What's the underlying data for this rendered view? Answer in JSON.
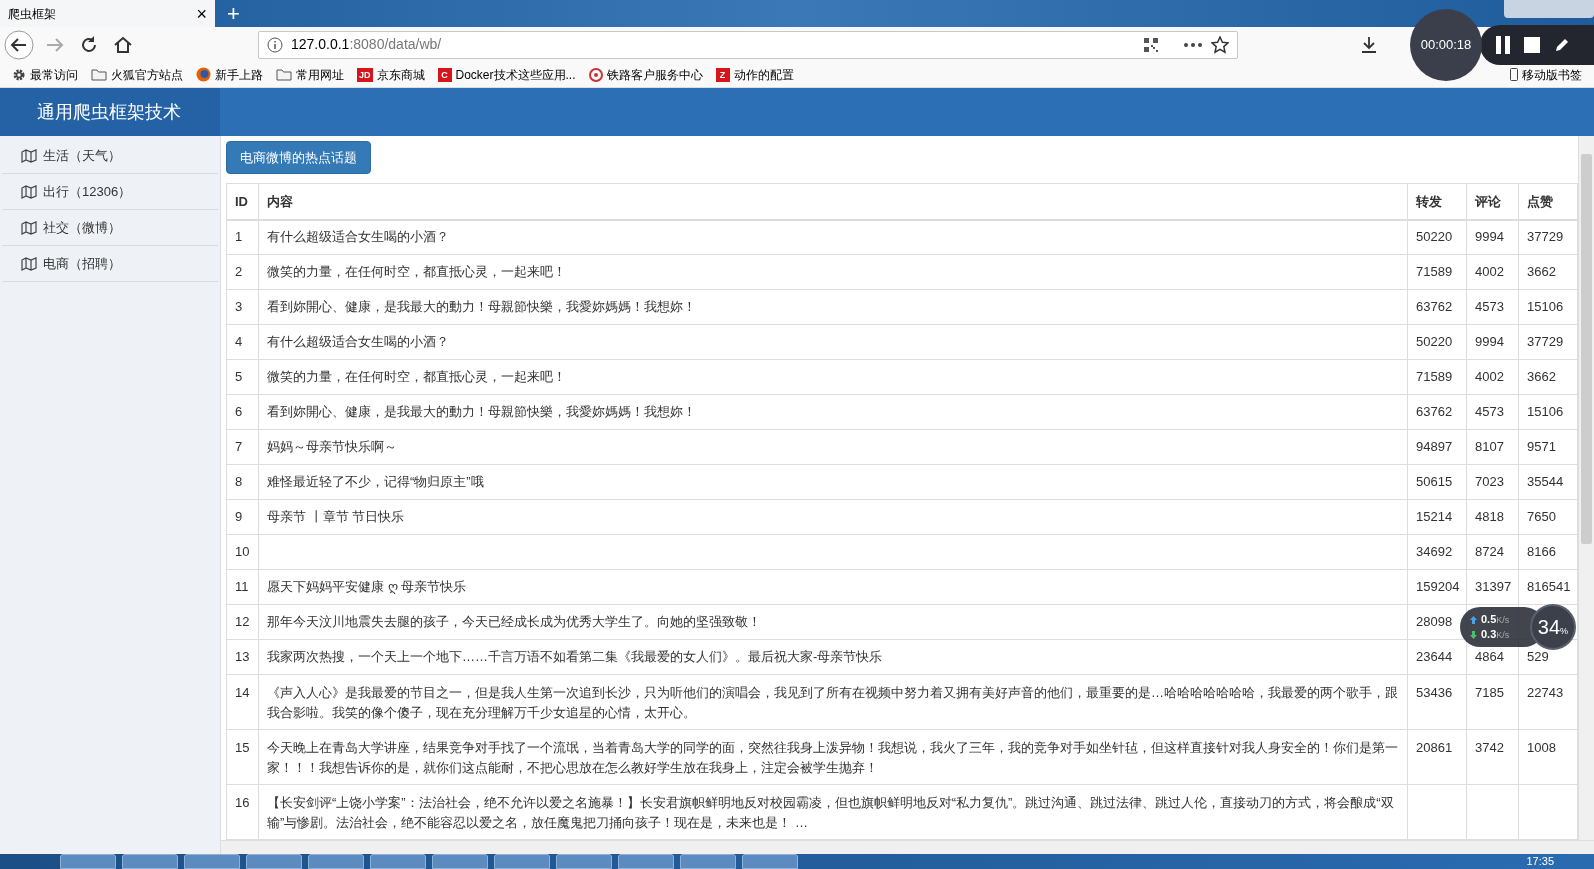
{
  "browser": {
    "tab": {
      "title": "爬虫框架",
      "close": "×"
    },
    "new_tab": "+",
    "url": {
      "host": "127.0.0.1",
      "rest": ":8080/data/wb/"
    },
    "bookmarks": [
      {
        "kind": "gear",
        "label": "最常访问"
      },
      {
        "kind": "folder",
        "label": "火狐官方站点"
      },
      {
        "kind": "globe",
        "label": "新手上路"
      },
      {
        "kind": "folder",
        "label": "常用网址"
      },
      {
        "kind": "badge",
        "badge": "JD",
        "label": "京东商城"
      },
      {
        "kind": "badge",
        "badge": "C",
        "label": "Docker技术这些应用..."
      },
      {
        "kind": "target",
        "label": "铁路客户服务中心"
      },
      {
        "kind": "badge",
        "badge": "Z",
        "label": "动作的配置"
      }
    ],
    "mobile_bookmarks": "移动版书签"
  },
  "recorder": {
    "time": "00:00:18"
  },
  "app": {
    "title": "通用爬虫框架技术"
  },
  "sidebar": {
    "items": [
      {
        "label": "生活（天气）"
      },
      {
        "label": "出行（12306）"
      },
      {
        "label": "社交（微博）"
      },
      {
        "label": "电商（招聘）"
      }
    ]
  },
  "topic_button": "电商微博的热点话题",
  "table": {
    "columns": [
      "ID",
      "内容",
      "转发",
      "评论",
      "点赞"
    ],
    "rows": [
      {
        "id": "1",
        "content": "有什么超级适合女生喝的小酒？",
        "reposts": "50220",
        "comments": "9994",
        "likes": "37729"
      },
      {
        "id": "2",
        "content": "微笑的力量，在任何时空，都直抵心灵，一起来吧！",
        "reposts": "71589",
        "comments": "4002",
        "likes": "3662"
      },
      {
        "id": "3",
        "content": "看到妳開心、健康，是我最大的動力！母親節快樂，我愛妳媽媽！我想妳！",
        "reposts": "63762",
        "comments": "4573",
        "likes": "15106"
      },
      {
        "id": "4",
        "content": "有什么超级适合女生喝的小酒？",
        "reposts": "50220",
        "comments": "9994",
        "likes": "37729"
      },
      {
        "id": "5",
        "content": "微笑的力量，在任何时空，都直抵心灵，一起来吧！",
        "reposts": "71589",
        "comments": "4002",
        "likes": "3662"
      },
      {
        "id": "6",
        "content": "看到妳開心、健康，是我最大的動力！母親節快樂，我愛妳媽媽！我想妳！",
        "reposts": "63762",
        "comments": "4573",
        "likes": "15106"
      },
      {
        "id": "7",
        "content": "妈妈～母亲节快乐啊～",
        "reposts": "94897",
        "comments": "8107",
        "likes": "9571"
      },
      {
        "id": "8",
        "content": "难怪最近轻了不少，记得“物归原主”哦",
        "reposts": "50615",
        "comments": "7023",
        "likes": "35544"
      },
      {
        "id": "9",
        "content": "母亲节 丨章节 节日快乐",
        "reposts": "15214",
        "comments": "4818",
        "likes": "7650"
      },
      {
        "id": "10",
        "reposts": "34692",
        "comments": "8724",
        "likes": "8166"
      },
      {
        "id": "11",
        "content": "愿天下妈妈平安健康 ღ 母亲节快乐",
        "reposts": "159204",
        "comments": "31397",
        "likes": "816541"
      },
      {
        "id": "12",
        "content": "那年今天汶川地震失去腿的孩子，今天已经成长成为优秀大学生了。向她的坚强致敬！",
        "reposts": "28098"
      },
      {
        "id": "13",
        "content": "我家两次热搜，一个天上一个地下……千言万语不如看第二集《我最爱的女人们》。最后祝大家-母亲节快乐",
        "reposts": "23644",
        "comments": "4864",
        "likes": "529"
      },
      {
        "id": "14",
        "content": "《声入人心》是我最爱的节目之一，但是我人生第一次追到长沙，只为听他们的演唱会，我见到了所有在视频中努力着又拥有美好声音的他们，最重要的是…哈哈哈哈哈哈哈，我最爱的两个歌手，跟我合影啦。我笑的像个傻子，现在充分理解万千少女追星的心情，太开心。",
        "reposts": "53436",
        "comments": "7185",
        "likes": "22743"
      },
      {
        "id": "15",
        "content": "今天晚上在青岛大学讲座，结果竞争对手找了一个流氓，当着青岛大学的同学的面，突然往我身上泼异物！我想说，我火了三年，我的竞争对手如坐针毡，但这样直接针对我人身安全的！你们是第一家！！！我想告诉你的是，就你们这点能耐，不把心思放在怎么教好学生放在我身上，注定会被学生抛弃！",
        "reposts": "20861",
        "comments": "3742",
        "likes": "1008"
      },
      {
        "id": "16",
        "content": "【长安剑评“上饶小学案”：法治社会，绝不允许以爱之名施暴！】长安君旗帜鲜明地反对校园霸凌，但也旗帜鲜明地反对“私力复仇”。跳过沟通、跳过法律、跳过人伦，直接动刀的方式，将会酿成“双输”与惨剧。法治社会，绝不能容忍以爱之名，放任魔鬼把刀捅向孩子！现在是，未来也是！ …"
      }
    ]
  },
  "net_meter": {
    "up": "0.5",
    "up_unit": "K/s",
    "down": "0.3",
    "down_unit": "K/s",
    "percent": "34",
    "percent_sign": "%"
  },
  "taskbar": {
    "clock": "17:35"
  }
}
